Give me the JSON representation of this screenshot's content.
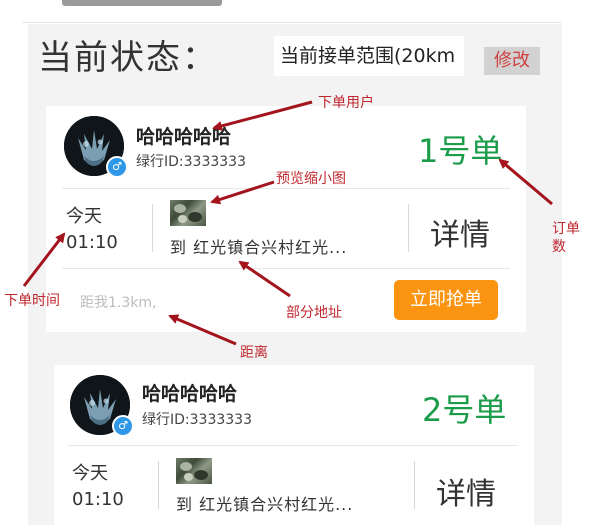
{
  "header": {
    "status_label": "当前状态：",
    "range_text": "当前接单范围(20km",
    "edit_label": "修改"
  },
  "orders": [
    {
      "username": "哈哈哈哈哈",
      "green_id": "绿行ID:3333333",
      "order_no": "1号单",
      "date": "今天",
      "time": "01:10",
      "address": "到 红光镇合兴村红光...",
      "detail_label": "详情",
      "distance": "距我1.3km,",
      "grab_label": "立即抢单"
    },
    {
      "username": "哈哈哈哈哈",
      "green_id": "绿行ID:3333333",
      "order_no": "2号单",
      "date": "今天",
      "time": "01:10",
      "address": "到 红光镇合兴村红光...",
      "detail_label": "详情"
    }
  ],
  "annotations": {
    "order_user": "下单用户",
    "thumbnail": "预览缩小图",
    "order_number_line1": "订单",
    "order_number_line2": "数",
    "order_time": "下单时间",
    "partial_address": "部分地址",
    "distance": "距离"
  },
  "colors": {
    "order_number": "#1b9c4a",
    "grab_button": "#fb9410",
    "edit_text": "#d04040",
    "annotation": "#c0282f"
  },
  "icons": {
    "avatar_badge": "verified-badge-icon",
    "thumbnail": "image-thumbnail-icon"
  }
}
